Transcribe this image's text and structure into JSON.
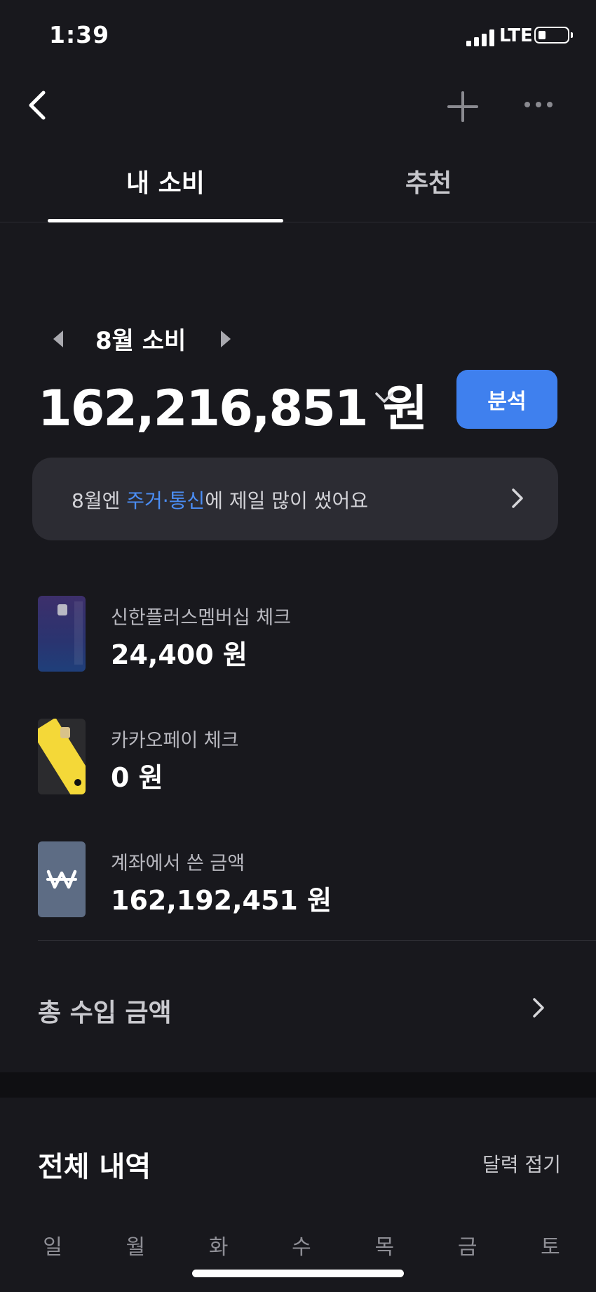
{
  "status_bar": {
    "time": "1:39",
    "network": "LTE"
  },
  "tabs": [
    {
      "label": "내 소비",
      "active": true
    },
    {
      "label": "추천",
      "active": false
    }
  ],
  "summary": {
    "month_label": "8월 소비",
    "total": "162,216,851 원",
    "analyze_label": "분석"
  },
  "insight": {
    "prefix": "8월엔 ",
    "highlight": "주거·통신",
    "suffix": "에 제일 많이 썼어요",
    "highlight_color": "#4b8ef5"
  },
  "accounts": [
    {
      "name": "신한플러스멤버십 체크",
      "amount": "24,400 원",
      "icon": "shinhan-card"
    },
    {
      "name": "카카오페이 체크",
      "amount": "0 원",
      "icon": "kakaopay-card"
    },
    {
      "name": "계좌에서 쓴 금액",
      "amount": "162,192,451 원",
      "icon": "won-icon"
    }
  ],
  "income": {
    "label": "총 수입 금액"
  },
  "history": {
    "title": "전체 내역",
    "collapse_label": "달력 접기",
    "weekdays": [
      "일",
      "월",
      "화",
      "수",
      "목",
      "금",
      "토"
    ]
  },
  "colors": {
    "accent": "#3f80ee",
    "background": "#18181d",
    "card_bg": "#2c2c33"
  }
}
